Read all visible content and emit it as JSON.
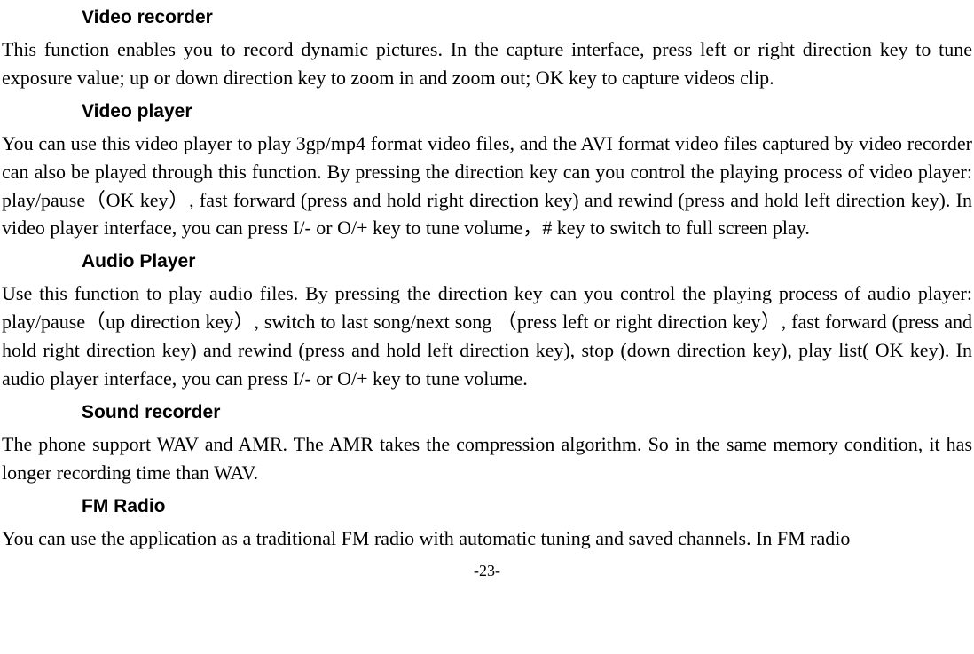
{
  "sections": {
    "video_recorder": {
      "heading": "Video recorder",
      "body": "This function enables you to record dynamic pictures. In the capture interface, press left or right direction key to tune exposure value; up or down direction key to zoom in and zoom out; OK key to capture videos clip."
    },
    "video_player": {
      "heading": "Video player",
      "body": "You can use this video player to play 3gp/mp4 format video files, and the AVI format video files captured by video recorder can also be played through this function. By pressing the direction key can you control the playing process of video player: play/pause（OK key）, fast forward (press and hold right direction key) and rewind (press and hold left direction key). In video player interface, you can press I/- or O/+ key to tune volume，# key to switch to full screen play."
    },
    "audio_player": {
      "heading": "Audio Player",
      "body": "Use this function to play audio files. By pressing the direction key can you control the playing process of audio player: play/pause（up direction key）, switch to last song/next song （press left or right direction key）, fast forward (press and hold right direction key) and rewind (press and hold left direction key), stop (down direction key), play list( OK key). In audio player interface, you can press I/- or O/+ key to tune volume."
    },
    "sound_recorder": {
      "heading": "Sound recorder",
      "body": "The phone support WAV and AMR. The AMR takes the compression algorithm. So in the same memory condition, it has longer recording time than WAV."
    },
    "fm_radio": {
      "heading": "FM Radio",
      "body": "You can use the application as a traditional FM radio with automatic tuning and saved channels. In FM radio"
    }
  },
  "page_number": "-23-"
}
